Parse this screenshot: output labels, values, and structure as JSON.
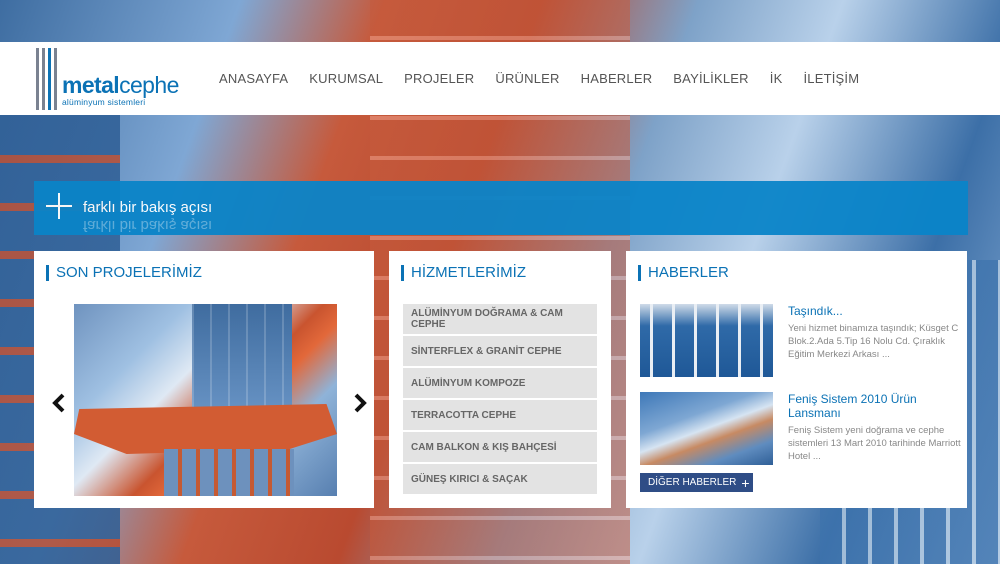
{
  "site": {
    "logo_main": "metal",
    "logo_second": "cephe",
    "logo_tagline": "alüminyum sistemleri"
  },
  "nav": {
    "items": [
      "ANASAYFA",
      "KURUMSAL",
      "PROJELER",
      "ÜRÜNLER",
      "HABERLER",
      "BAYİLİKLER",
      "İK",
      "İLETİŞİM"
    ]
  },
  "banner": {
    "text": "farklı bir bakış açısı"
  },
  "projects": {
    "title": "SON PROJELERİMİZ"
  },
  "services": {
    "title": "HİZMETLERİMİZ",
    "items": [
      "ALÜMİNYUM DOĞRAMA & CAM CEPHE",
      "SİNTERFLEX & GRANİT CEPHE",
      "ALÜMİNYUM KOMPOZE",
      "TERRACOTTA CEPHE",
      "CAM BALKON & KIŞ BAHÇESİ",
      "GÜNEŞ KIRICI & SAÇAK"
    ]
  },
  "news": {
    "title": "HABERLER",
    "items": [
      {
        "title": "Taşındık...",
        "body": "Yeni hizmet binamıza taşındık; Küsget C Blok.2.Ada 5.Tip 16 Nolu Cd. Çıraklık Eğitim Merkezi Arkası  ..."
      },
      {
        "title": "Feniş Sistem 2010 Ürün Lansmanı",
        "body": "Feniş Sistem yeni doğrama ve cephe sistemleri 13 Mart 2010 tarihinde Marriott Hotel ..."
      }
    ],
    "more_label": "DİĞER HABERLER",
    "more_plus": "+"
  },
  "colors": {
    "accent": "#0b72b5",
    "banner": "#0a84c8",
    "button": "#2f4d86"
  }
}
